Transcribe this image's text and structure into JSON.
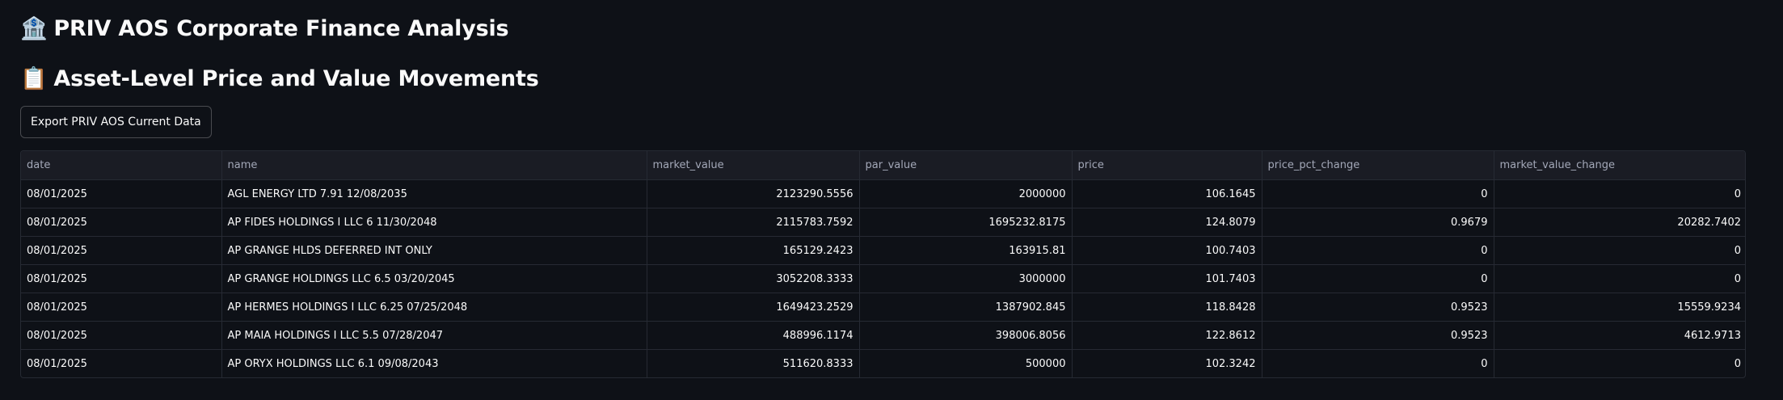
{
  "header": {
    "title_icon": "🏦",
    "title": "PRIV AOS Corporate Finance Analysis",
    "section_icon": "📋",
    "section_title": "Asset-Level Price and Value Movements"
  },
  "toolbar": {
    "export_label": "Export PRIV AOS Current Data"
  },
  "table": {
    "columns": [
      "date",
      "name",
      "market_value",
      "par_value",
      "price",
      "price_pct_change",
      "market_value_change"
    ],
    "rows": [
      [
        "08/01/2025",
        "AGL ENERGY LTD 7.91 12/08/2035",
        "2123290.5556",
        "2000000",
        "106.1645",
        "0",
        "0"
      ],
      [
        "08/01/2025",
        "AP FIDES HOLDINGS I LLC 6 11/30/2048",
        "2115783.7592",
        "1695232.8175",
        "124.8079",
        "0.9679",
        "20282.7402"
      ],
      [
        "08/01/2025",
        "AP GRANGE HLDS DEFERRED INT ONLY",
        "165129.2423",
        "163915.81",
        "100.7403",
        "0",
        "0"
      ],
      [
        "08/01/2025",
        "AP GRANGE HOLDINGS LLC 6.5 03/20/2045",
        "3052208.3333",
        "3000000",
        "101.7403",
        "0",
        "0"
      ],
      [
        "08/01/2025",
        "AP HERMES HOLDINGS I LLC 6.25 07/25/2048",
        "1649423.2529",
        "1387902.845",
        "118.8428",
        "0.9523",
        "15559.9234"
      ],
      [
        "08/01/2025",
        "AP MAIA HOLDINGS I LLC 5.5 07/28/2047",
        "488996.1174",
        "398006.8056",
        "122.8612",
        "0.9523",
        "4612.9713"
      ],
      [
        "08/01/2025",
        "AP ORYX HOLDINGS LLC 6.1 09/08/2043",
        "511620.8333",
        "500000",
        "102.3242",
        "0",
        "0"
      ]
    ]
  }
}
